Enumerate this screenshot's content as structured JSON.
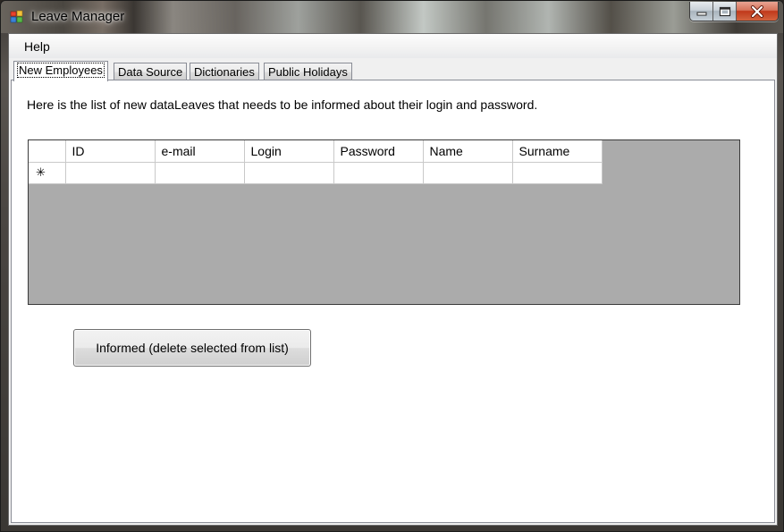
{
  "window": {
    "title": "Leave Manager",
    "icon": "app-windows-icon"
  },
  "caption": {
    "minimize_icon": "minimize-icon",
    "maximize_icon": "maximize-icon",
    "close_icon": "close-icon"
  },
  "menu": {
    "items": [
      {
        "label": "Help"
      }
    ]
  },
  "tabs": [
    {
      "label": "New Employees",
      "active": true
    },
    {
      "label": "Data Source",
      "active": false
    },
    {
      "label": "Dictionaries",
      "active": false
    },
    {
      "label": "Public Holidays",
      "active": false
    }
  ],
  "new_employees": {
    "info_text": "Here is the list of new dataLeaves that needs to be informed about their login and password.",
    "grid": {
      "columns": [
        "ID",
        "e-mail",
        "Login",
        "Password",
        "Name",
        "Surname"
      ],
      "new_row_marker": "✳",
      "rows": []
    },
    "button_label": "Informed (delete selected from list)"
  },
  "colors": {
    "grid_background": "#ababab",
    "panel_background": "#ffffff",
    "close_button": "#c0391b"
  }
}
